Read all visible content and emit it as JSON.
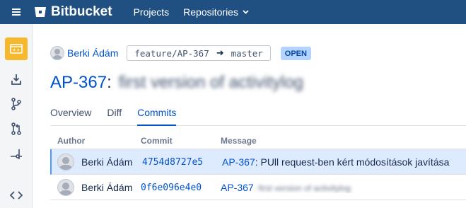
{
  "topbar": {
    "app_name": "Bitbucket",
    "nav": [
      {
        "label": "Projects"
      },
      {
        "label": "Repositories"
      }
    ]
  },
  "sidebar": {
    "icons": [
      "repository-icon",
      "clone-icon",
      "branches-icon",
      "pull-requests-icon",
      "commits-icon",
      "source-icon"
    ]
  },
  "pr": {
    "author": "Berki Ádám",
    "source_branch": "feature/AP-367",
    "target_branch": "master",
    "status": "OPEN",
    "key": "AP-367",
    "colon": ":",
    "title_rest": "first version of activitylog"
  },
  "tabs": [
    {
      "label": "Overview"
    },
    {
      "label": "Diff"
    },
    {
      "label": "Commits"
    }
  ],
  "commits": {
    "columns": {
      "author": "Author",
      "commit": "Commit",
      "message": "Message"
    },
    "rows": [
      {
        "author": "Berki Ádám",
        "hash": "4754d8727e5",
        "issue": "AP-367",
        "message": ": PUll request-ben kért módosítások javítása"
      },
      {
        "author": "Berki Ádám",
        "hash": "0f6e096e4e0",
        "issue": "AP-367",
        "message": ": first version of activitylog"
      }
    ]
  },
  "colors": {
    "header_bg": "#205081",
    "link": "#0052cc",
    "active_sidebar": "#f5b82e",
    "badge_bg": "#b3d4ff",
    "selected_row": "#deebff"
  }
}
